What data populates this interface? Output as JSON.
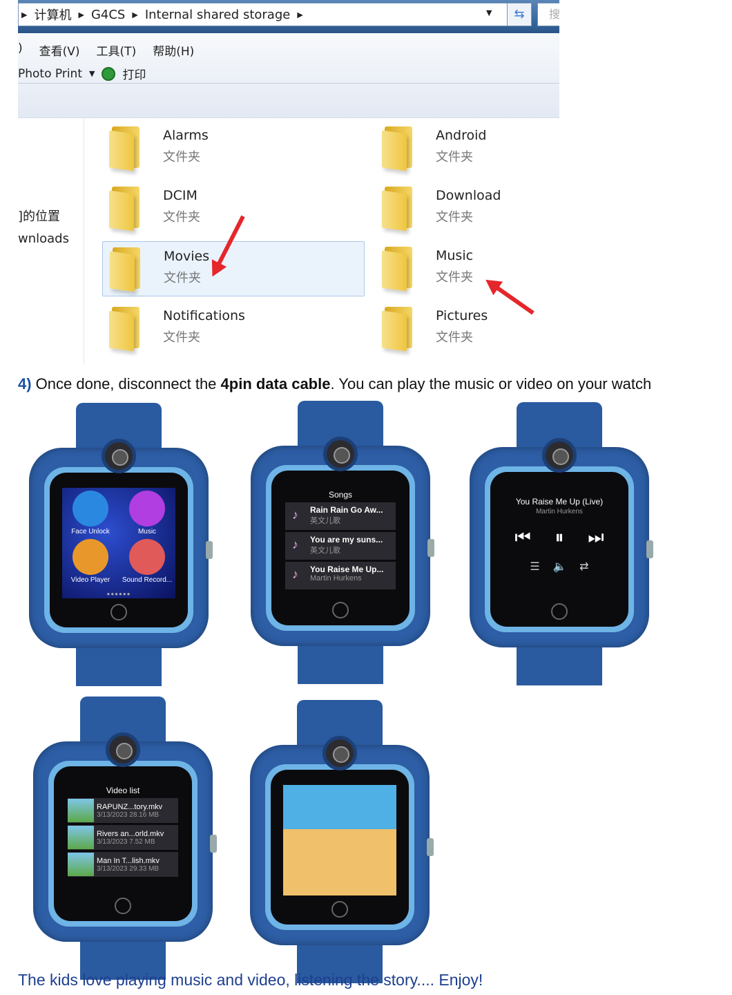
{
  "explorer": {
    "breadcrumb": [
      "计算机",
      "G4CS",
      "Internal shared storage"
    ],
    "search_glyph": "搜",
    "menus": [
      ")",
      "查看(V)",
      "工具(T)",
      "帮助(H)"
    ],
    "toolbar": {
      "photo_print": "Photo Print",
      "print": "打印"
    },
    "nav": [
      "]的位置",
      "wnloads"
    ],
    "folders": [
      {
        "name": "Alarms",
        "type": "文件夹"
      },
      {
        "name": "Android",
        "type": "文件夹"
      },
      {
        "name": "DCIM",
        "type": "文件夹"
      },
      {
        "name": "Download",
        "type": "文件夹"
      },
      {
        "name": "Movies",
        "type": "文件夹",
        "selected": true
      },
      {
        "name": "Music",
        "type": "文件夹"
      },
      {
        "name": "Notifications",
        "type": "文件夹"
      },
      {
        "name": "Pictures",
        "type": "文件夹"
      }
    ],
    "arrow_color": "#e5262b"
  },
  "step": {
    "num": "4)",
    "pre": " Once done, disconnect the ",
    "bold": "4pin data cable",
    "post": ". You can play the music or video on your watch"
  },
  "watch1": {
    "apps": [
      "Face Unlock",
      "Music",
      "Video Player",
      "Sound Record..."
    ]
  },
  "watch2": {
    "title": "Songs",
    "songs": [
      {
        "title": "Rain Rain Go Aw...",
        "sub": "英文儿歌"
      },
      {
        "title": "You are my suns...",
        "sub": "英文儿歌"
      },
      {
        "title": "You Raise Me Up...",
        "sub": "Martin Hurkens"
      }
    ]
  },
  "watch3": {
    "title": "You Raise Me Up (Live)",
    "artist": "Martin Hurkens"
  },
  "watch4": {
    "title": "Video list",
    "videos": [
      {
        "name": "RAPUNZ...tory.mkv",
        "meta": "3/13/2023  28.16 MB"
      },
      {
        "name": "Rivers an...orld.mkv",
        "meta": "3/13/2023  7.52 MB"
      },
      {
        "name": "Man In T...lish.mkv",
        "meta": "3/13/2023  29.33 MB"
      }
    ]
  },
  "footer": "The kids love playing music and video, listening the story.... Enjoy!",
  "colors": {
    "watch_body": "#2d5ea6",
    "bezel": "#6eb4e6",
    "step_number": "#1d4fa3",
    "footer_text": "#1d3f8f"
  }
}
